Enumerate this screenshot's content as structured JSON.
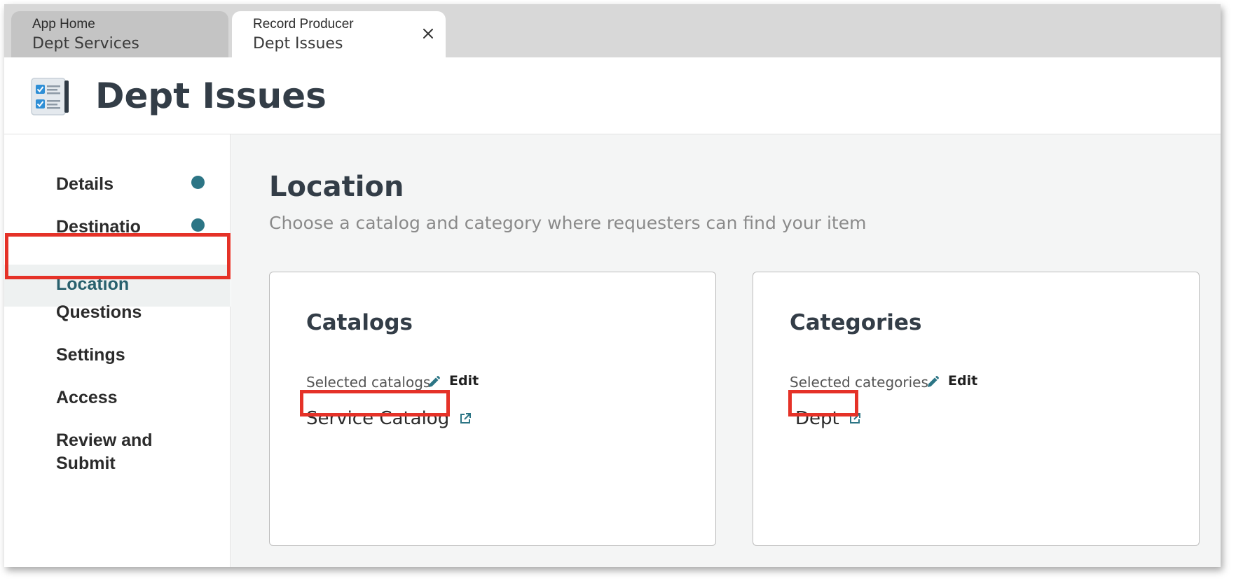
{
  "tabs": [
    {
      "subtitle": "App Home",
      "title": "Dept Services",
      "active": false
    },
    {
      "subtitle": "Record Producer",
      "title": "Dept Issues",
      "active": true,
      "closable": true
    }
  ],
  "header": {
    "title": "Dept Issues",
    "icon": "checklist-form-icon"
  },
  "sidebar": {
    "items": [
      {
        "label": "Details",
        "completed": true
      },
      {
        "label": "Destinatio",
        "completed": true
      },
      {
        "label": "Location",
        "active": true
      },
      {
        "label": "Questions"
      },
      {
        "label": "Settings"
      },
      {
        "label": "Access"
      },
      {
        "label": "Review and Submit"
      }
    ]
  },
  "main": {
    "title": "Location",
    "description": "Choose a catalog and category where requesters can find your item",
    "catalogs": {
      "title": "Catalogs",
      "selected_label": "Selected catalogs",
      "edit_label": "Edit",
      "selected_value": "Service Catalog"
    },
    "categories": {
      "title": "Categories",
      "selected_label": "Selected categories",
      "edit_label": "Edit",
      "selected_value": "Dept"
    }
  },
  "colors": {
    "accent": "#2c7585",
    "highlight": "#e53228",
    "title_text": "#333d47",
    "tab_bar": "#d8d8d8"
  }
}
